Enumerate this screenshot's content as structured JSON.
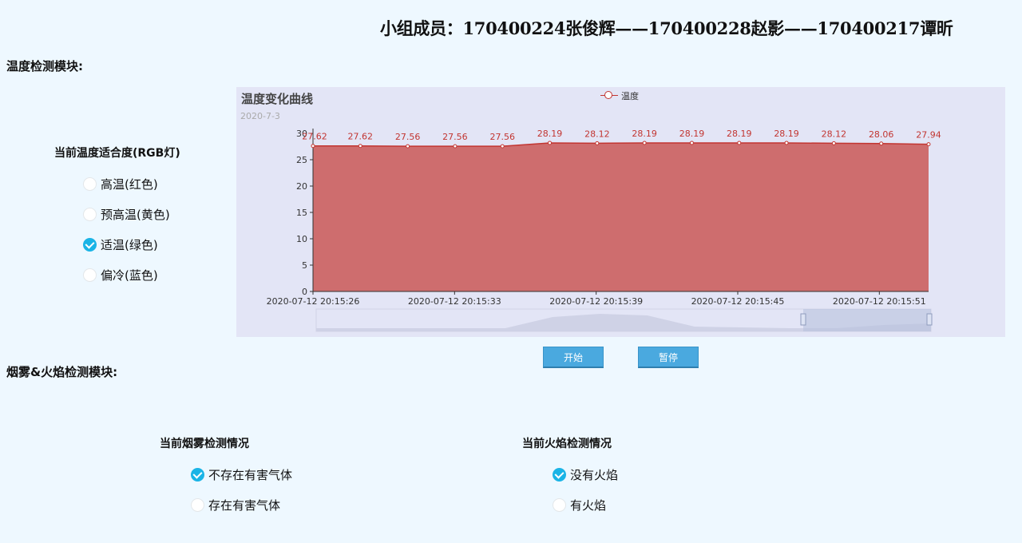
{
  "header": {
    "title": "小组成员：170400224张俊辉——170400228赵影——170400217谭昕"
  },
  "temperature_section": {
    "title": "温度检测模块:",
    "rgb_title": "当前温度适合度(RGB灯)",
    "options": [
      {
        "label": "高温(红色)",
        "checked": false
      },
      {
        "label": "预高温(黄色)",
        "checked": false
      },
      {
        "label": "适温(绿色)",
        "checked": true
      },
      {
        "label": "偏冷(蓝色)",
        "checked": false
      }
    ]
  },
  "chart_data": {
    "type": "area",
    "title": "温度变化曲线",
    "subtitle": "2020-7-3",
    "series": [
      {
        "name": "温度",
        "values": [
          27.62,
          27.62,
          27.56,
          27.56,
          27.56,
          28.19,
          28.12,
          28.19,
          28.19,
          28.19,
          28.19,
          28.12,
          28.06,
          27.94
        ]
      }
    ],
    "x_tick_labels": [
      "2020-07-12 20:15:26",
      "2020-07-12 20:15:33",
      "2020-07-12 20:15:39",
      "2020-07-12 20:15:45",
      "2020-07-12 20:15:51"
    ],
    "y_ticks": [
      0,
      5,
      10,
      15,
      20,
      25,
      30
    ],
    "ylim": [
      0,
      30
    ],
    "color": "#c23531",
    "area_color": "#cc6666",
    "background": "#e3e5f6",
    "legend_position": "top-center",
    "grid": false,
    "data_zoom": true
  },
  "buttons": {
    "start": "开始",
    "pause": "暂停"
  },
  "smoke_fire_section": {
    "title": "烟雾&火焰检测模块:",
    "smoke": {
      "title": "当前烟雾检测情况",
      "options": [
        {
          "label": "不存在有害气体",
          "checked": true
        },
        {
          "label": "存在有害气体",
          "checked": false
        }
      ]
    },
    "fire": {
      "title": "当前火焰检测情况",
      "options": [
        {
          "label": "没有火焰",
          "checked": true
        },
        {
          "label": "有火焰",
          "checked": false
        }
      ]
    }
  },
  "colors": {
    "page_background": "#eef8ff",
    "checked": "#1ab4e6",
    "button": "#4aa9df"
  }
}
